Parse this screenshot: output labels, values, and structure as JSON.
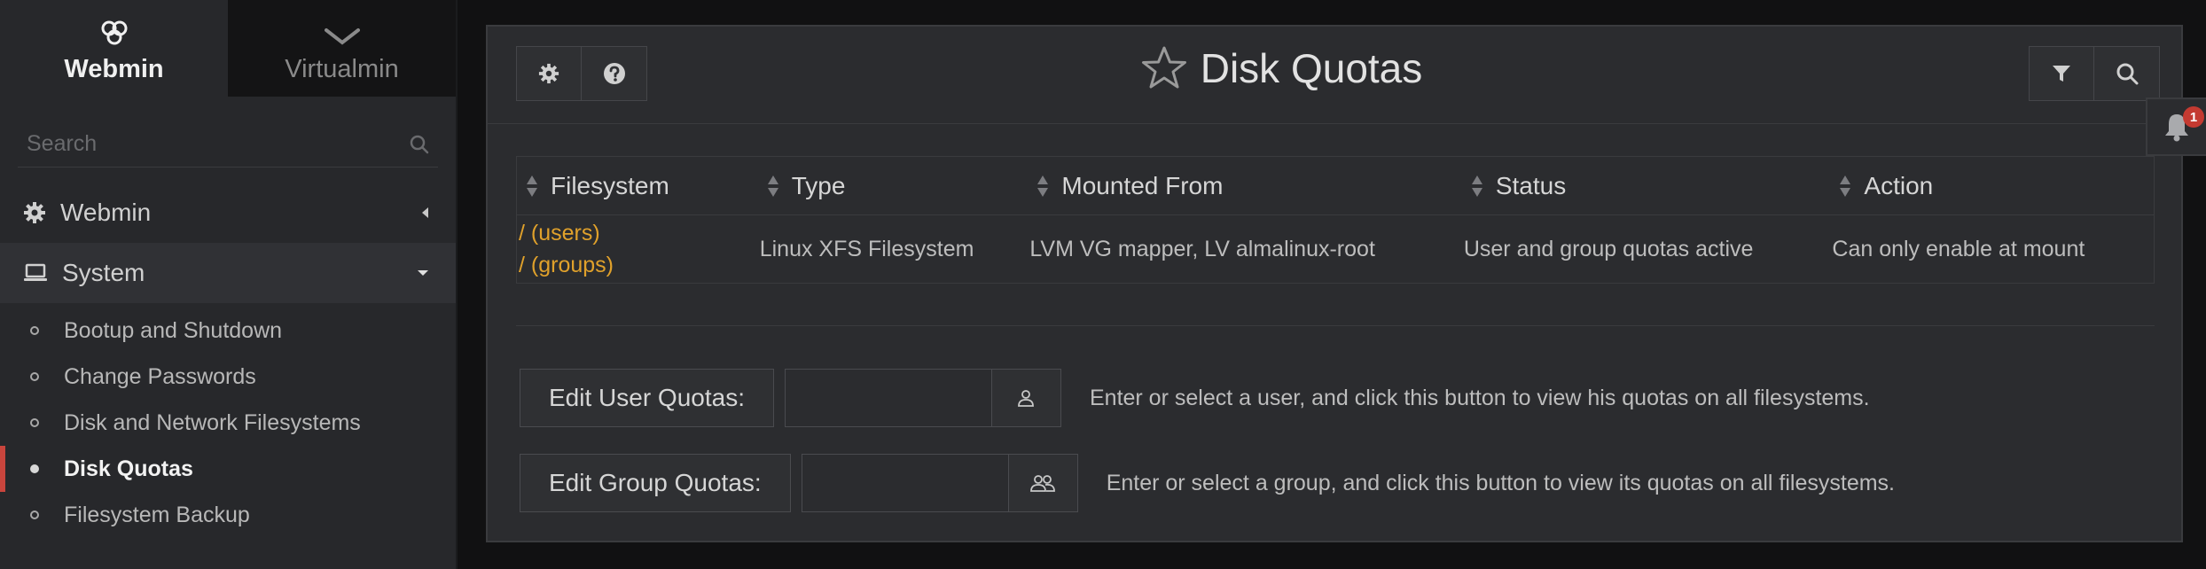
{
  "colors": {
    "sidebar_bg": "#27282b",
    "panel_bg": "#2b2c2f",
    "link": "#e0a12b",
    "active_marker": "#c9453d",
    "badge": "#c43a31"
  },
  "sidebar": {
    "switch": [
      {
        "label": "Webmin",
        "icon": "webmin-logo-icon",
        "active": true
      },
      {
        "label": "Virtualmin",
        "icon": "virtualmin-logo-icon",
        "active": false
      }
    ],
    "search_placeholder": "Search",
    "categories": [
      {
        "label": "Webmin",
        "icon": "gear-icon",
        "expanded": false
      },
      {
        "label": "System",
        "icon": "laptop-icon",
        "expanded": true
      }
    ],
    "items": [
      {
        "label": "Bootup and Shutdown",
        "active": false
      },
      {
        "label": "Change Passwords",
        "active": false
      },
      {
        "label": "Disk and Network Filesystems",
        "active": false
      },
      {
        "label": "Disk Quotas",
        "active": true
      },
      {
        "label": "Filesystem Backup",
        "active": false
      }
    ]
  },
  "header": {
    "title": "Disk Quotas",
    "left_buttons": [
      "gear-icon",
      "help-icon"
    ],
    "right_buttons": [
      "filter-icon",
      "search-icon"
    ]
  },
  "table": {
    "columns": [
      "Filesystem",
      "Type",
      "Mounted From",
      "Status",
      "Action"
    ],
    "rows": [
      {
        "filesystem_links": [
          "/ (users)",
          "/ (groups)"
        ],
        "type": "Linux XFS Filesystem",
        "mounted_from": "LVM VG mapper, LV almalinux-root",
        "status": "User and group quotas active",
        "action": "Can only enable at mount"
      }
    ]
  },
  "user_quota": {
    "button_label": "Edit User Quotas:",
    "input_value": "",
    "description": "Enter or select a user, and click this button to view his quotas on all filesystems."
  },
  "group_quota": {
    "button_label": "Edit Group Quotas:",
    "input_value": "",
    "description": "Enter or select a group, and click this button to view its quotas on all filesystems."
  },
  "notifications": {
    "count": "1"
  }
}
